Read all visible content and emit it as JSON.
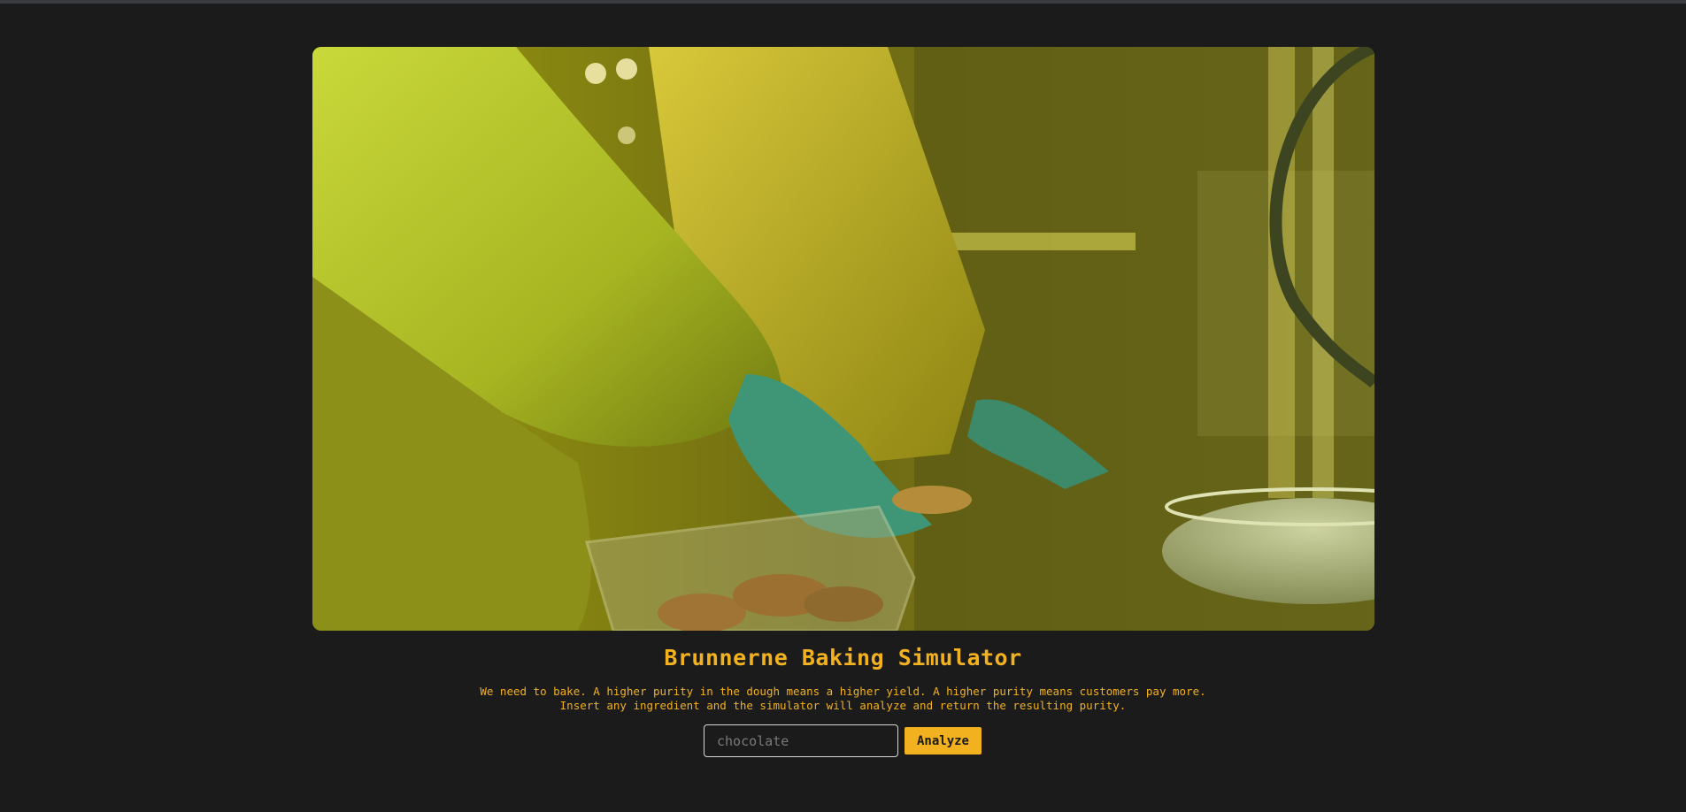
{
  "colors": {
    "background": "#1b1b1b",
    "accent": "#f2b11f",
    "input_border": "#d8d8d8"
  },
  "hero": {
    "image_icon": "lab-worker-cookies-photo"
  },
  "header": {
    "title": "Brunnerne Baking Simulator"
  },
  "description": {
    "line1": "We need to bake. A higher purity in the dough means a higher yield. A higher purity means customers pay more.",
    "line2": "Insert any ingredient and the simulator will analyze and return the resulting purity."
  },
  "form": {
    "ingredient_placeholder": "chocolate",
    "ingredient_value": "",
    "analyze_label": "Analyze"
  }
}
